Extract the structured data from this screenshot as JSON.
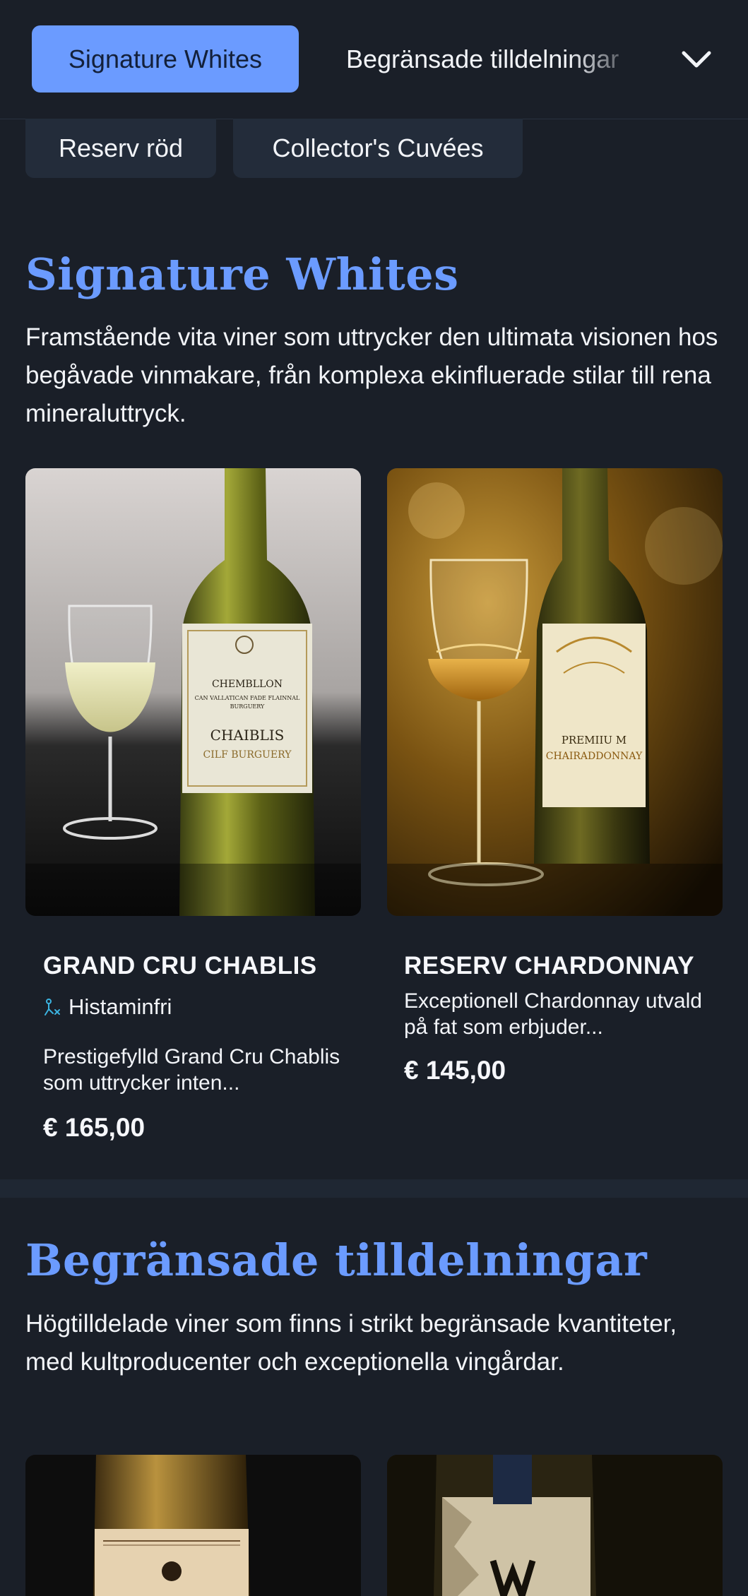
{
  "nav": {
    "active_tab": "Signature Whites",
    "next_tab": "Begränsade tilldelningar",
    "chips": [
      "Reserv röd",
      "Collector's Cuvées"
    ]
  },
  "sections": [
    {
      "title": "Signature Whites",
      "description": "Framstående vita viner som uttrycker den ultimata visionen hos begåvade vinmakare, från komplexa ekinfluerade stilar till rena mineraluttryck.",
      "products": [
        {
          "name": "GRAND CRU CHABLIS",
          "tag": "Histaminfri",
          "description": "Prestigefylld Grand Cru Chablis som uttrycker inten...",
          "price": "€ 165,00",
          "label_lines": [
            "CHEMBLLON",
            "CAN VALLATICAN FADE FLAINNAL",
            "BURGUERY",
            "CHAIBLIS",
            "CILF BURGUERY"
          ]
        },
        {
          "name": "RESERV CHARDONNAY",
          "description": "Exceptionell Chardonnay utvald på fat som erbjuder...",
          "price": "€ 145,00",
          "label_lines": [
            "PREMIIU M",
            "CHAIRADDONNAY"
          ]
        }
      ]
    },
    {
      "title": "Begränsade tilldelningar",
      "description": "Högtilldelade viner som finns i strikt begränsade kvantiteter, med kultproducenter och exceptionella vingårdar."
    }
  ],
  "colors": {
    "background": "#1a1f28",
    "accent": "#6b9bff",
    "chip": "#232c3a",
    "tag_icon": "#3bb3e0"
  },
  "icons": {
    "nav_toggle": "chevron-down-icon",
    "tag": "histamine-free-icon"
  }
}
